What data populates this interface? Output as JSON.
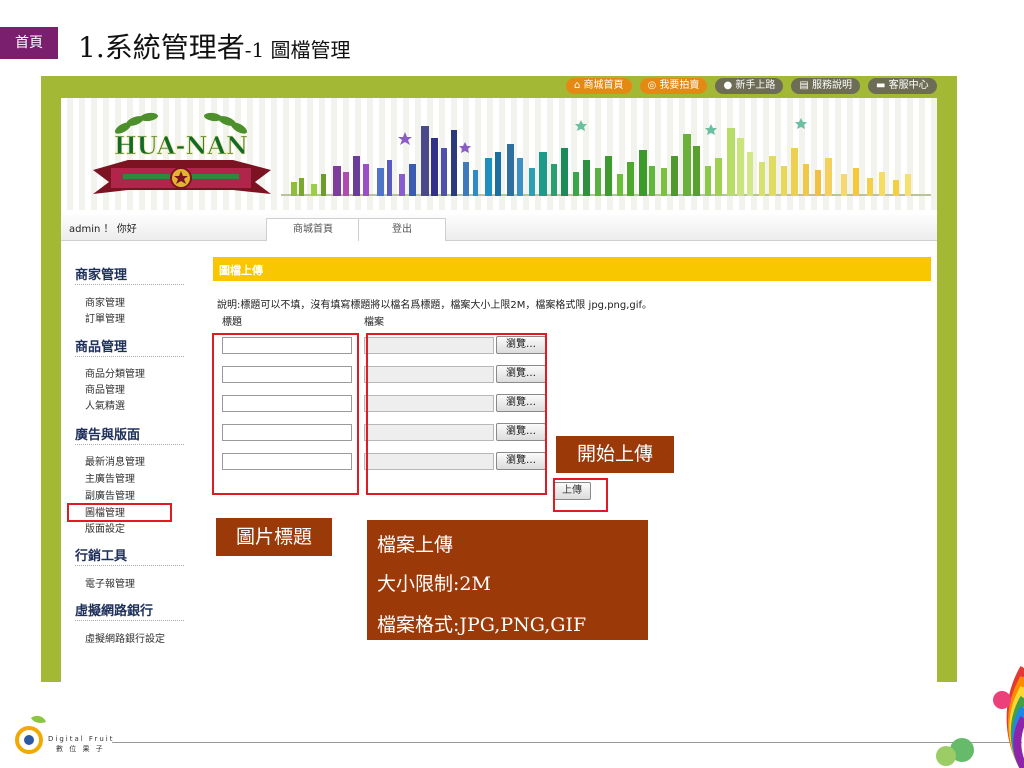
{
  "slide": {
    "home_tag": "首頁",
    "title_main": "1.系統管理者",
    "title_sub": "-1 圖檔管理"
  },
  "topnav": [
    "商城首頁",
    "我要拍賣",
    "新手上路",
    "服務說明",
    "客服中心"
  ],
  "logo": {
    "text": "HUA-NAN"
  },
  "statusbar": {
    "greeting": "admin ！ 你好",
    "tabs": [
      "商城首頁",
      "登出"
    ]
  },
  "sidebar": {
    "groups": [
      {
        "title": "商家管理",
        "items": [
          "商家管理",
          "訂單管理"
        ]
      },
      {
        "title": "商品管理",
        "items": [
          "商品分類管理",
          "商品管理",
          "人氣精選"
        ]
      },
      {
        "title": "廣告與版面",
        "items": [
          "最新消息管理",
          "主廣告管理",
          "副廣告管理",
          "圖檔管理",
          "版面設定"
        ]
      },
      {
        "title": "行銷工具",
        "items": [
          "電子報管理"
        ]
      },
      {
        "title": "虛擬網路銀行",
        "items": [
          "虛擬網路銀行設定"
        ]
      }
    ]
  },
  "main": {
    "section_title": "圖檔上傳",
    "instructions": "說明:標題可以不填，沒有填寫標題將以檔名爲標題，檔案大小上限2M，檔案格式限 jpg,png,gif。",
    "col_title": "標題",
    "col_file": "檔案",
    "browse_label": "瀏覽…",
    "upload_label": "上傳",
    "rows": [
      {
        "title": ""
      },
      {
        "title": ""
      },
      {
        "title": ""
      },
      {
        "title": ""
      },
      {
        "title": ""
      }
    ]
  },
  "callouts": {
    "start_upload": "開始上傳",
    "image_title": "圖片標題",
    "file_upload": "檔案上傳",
    "size_limit": "大小限制:2M",
    "file_format": "檔案格式:JPG,PNG,GIF"
  },
  "footer": {
    "brand_line1": "Digital Fruit",
    "brand_line2": "數 位 果 子"
  },
  "colors": {
    "frame_green": "#a3b834",
    "section_yellow": "#f9c700",
    "callout_brown": "#9b3a08",
    "annotation_red": "#e01b24",
    "home_tag_purple": "#7a1e6e"
  }
}
